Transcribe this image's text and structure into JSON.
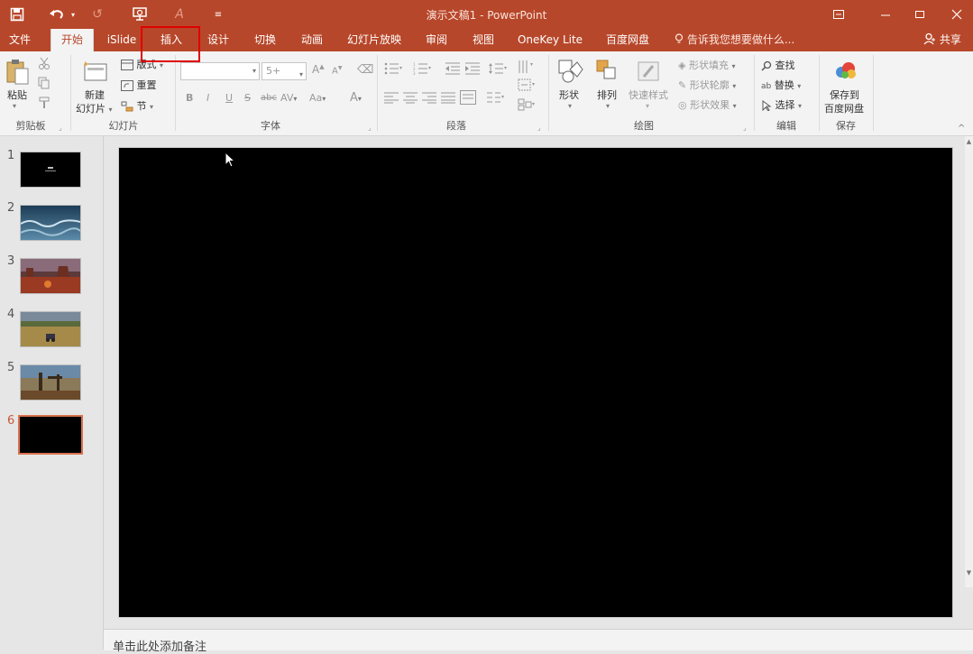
{
  "window": {
    "title": "演示文稿1 - PowerPoint"
  },
  "quick_access": {
    "icons": [
      "save-icon",
      "undo-icon",
      "redo-icon",
      "presenter-icon",
      "pen-icon",
      "customize-icon"
    ]
  },
  "tabs": [
    {
      "label": "文件"
    },
    {
      "label": "开始"
    },
    {
      "label": "iSlide"
    },
    {
      "label": "插入"
    },
    {
      "label": "设计"
    },
    {
      "label": "切换"
    },
    {
      "label": "动画"
    },
    {
      "label": "幻灯片放映"
    },
    {
      "label": "审阅"
    },
    {
      "label": "视图"
    },
    {
      "label": "OneKey Lite"
    },
    {
      "label": "百度网盘"
    }
  ],
  "tell_me": "告诉我您想要做什么...",
  "share": "共享",
  "ribbon": {
    "clipboard": {
      "paste": "粘贴",
      "label": "剪贴板"
    },
    "slides": {
      "new_slide_1": "新建",
      "new_slide_2": "幻灯片",
      "layout": "版式",
      "reset": "重置",
      "section": "节",
      "label": "幻灯片"
    },
    "font": {
      "size_placeholder": "5+",
      "bold": "B",
      "italic": "I",
      "underline": "U",
      "strike": "S",
      "abc": "abc",
      "av": "AV",
      "aa": "Aa",
      "a_color": "A",
      "label": "字体"
    },
    "paragraph": {
      "label": "段落"
    },
    "drawing": {
      "shape": "形状",
      "arrange": "排列",
      "quick_styles": "快速样式",
      "fill": "形状填充",
      "outline": "形状轮廓",
      "effects": "形状效果",
      "label": "绘图"
    },
    "editing": {
      "find": "查找",
      "replace": "替换",
      "select": "选择",
      "label": "编辑"
    },
    "save": {
      "save_1": "保存到",
      "save_2": "百度网盘",
      "label": "保存"
    }
  },
  "thumbnails": [
    {
      "num": "1",
      "selected": false,
      "style": "dark-title"
    },
    {
      "num": "2",
      "selected": false,
      "style": "ocean"
    },
    {
      "num": "3",
      "selected": false,
      "style": "desert"
    },
    {
      "num": "4",
      "selected": false,
      "style": "field"
    },
    {
      "num": "5",
      "selected": false,
      "style": "oilrig"
    },
    {
      "num": "6",
      "selected": true,
      "style": "black"
    }
  ],
  "notes": {
    "placeholder": "单击此处添加备注"
  },
  "colors": {
    "accent": "#b7472a",
    "slide_bg": "#000000"
  }
}
